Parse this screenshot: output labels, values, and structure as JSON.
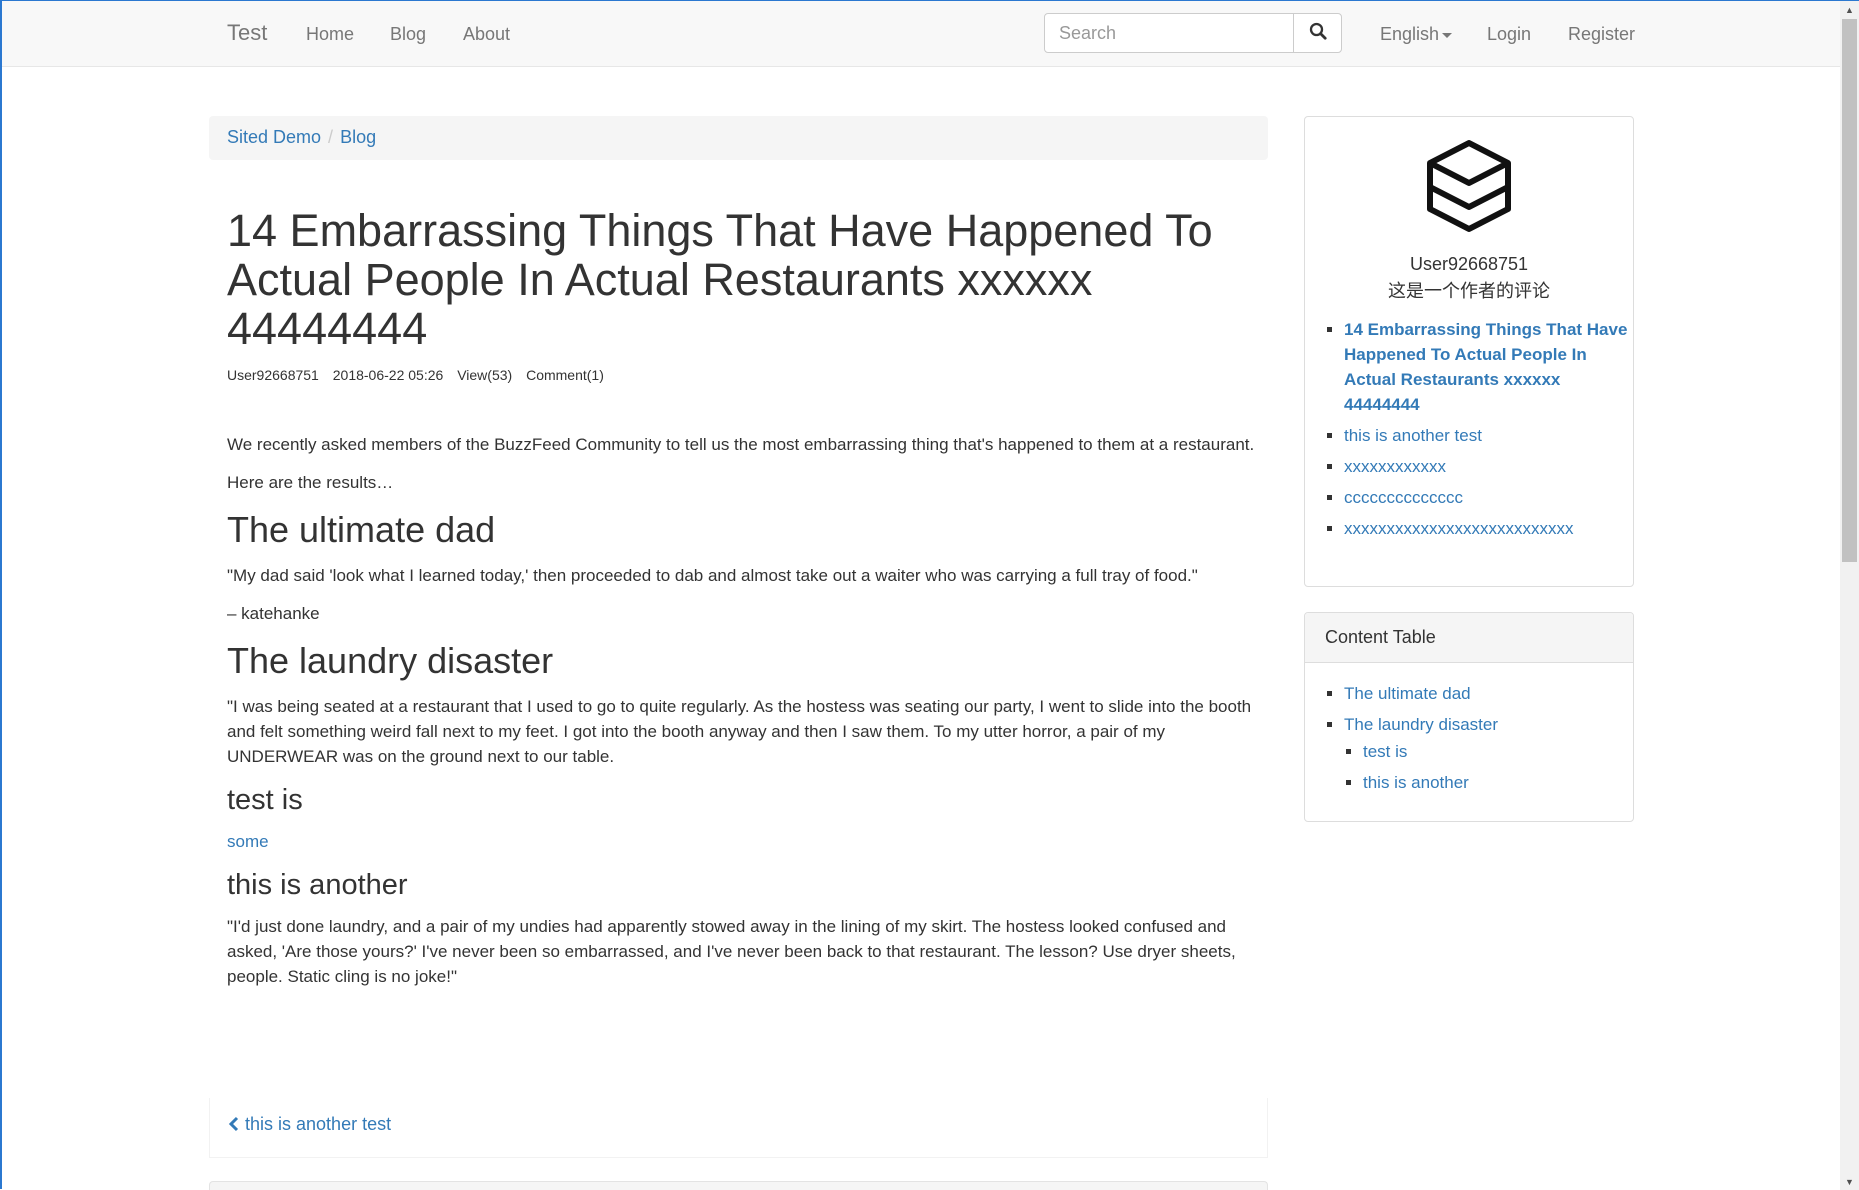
{
  "navbar": {
    "brand": "Test",
    "links": [
      "Home",
      "Blog",
      "About"
    ],
    "search_placeholder": "Search",
    "language": "English",
    "login": "Login",
    "register": "Register"
  },
  "breadcrumb": [
    "Sited Demo",
    "Blog"
  ],
  "article": {
    "title": "14 Embarrassing Things That Have Happened To Actual People In Actual Restaurants xxxxxx 44444444",
    "meta": {
      "author": "User92668751",
      "date": "2018-06-22 05:26",
      "views": "View(53)",
      "comments": "Comment(1)"
    },
    "intro": "We recently asked members of the BuzzFeed Community to tell us the most embarrassing thing that's happened to them at a restaurant.",
    "intro2": "Here are the results…",
    "sections": [
      {
        "heading": "The ultimate dad",
        "para": "\"My dad said 'look what I learned today,' then proceeded to dab and almost take out a waiter who was carrying a full tray of food.\"",
        "para2": "– katehanke"
      },
      {
        "heading": "The laundry disaster",
        "para": "\"I was being seated at a restaurant that I used to go to quite regularly. As the hostess was seating our party, I went to slide into the booth and felt something weird fall next to my feet. I got into the booth anyway and then I saw them. To my utter horror, a pair of my UNDERWEAR was on the ground next to our table."
      },
      {
        "heading": "test is",
        "link": "some"
      },
      {
        "heading": "this is another",
        "para": "\"I'd just done laundry, and a pair of my undies had apparently stowed away in the lining of my skirt. The hostess looked confused and asked, 'Are those yours?' I've never been so embarrassed, and I've never been back to that restaurant. The lesson? Use dryer sheets, people. Static cling is no joke!\""
      }
    ],
    "prev_link": "this is another test"
  },
  "sidebar": {
    "author": {
      "name": "User92668751",
      "bio": "这是一个作者的评论"
    },
    "posts": [
      "14 Embarrassing Things That Have Happened To Actual People In Actual Restaurants xxxxxx 44444444",
      "this is another test",
      "xxxxxxxxxxxx",
      "cccccccccccccc",
      "xxxxxxxxxxxxxxxxxxxxxxxxxxx"
    ],
    "toc": {
      "heading": "Content Table",
      "items": [
        "The ultimate dad",
        "The laundry disaster"
      ],
      "subitems": [
        "test is",
        "this is another"
      ]
    }
  },
  "colors": {
    "link": "#337ab7",
    "text": "#333333",
    "navbar_bg": "#f8f8f8",
    "muted": "#777777"
  }
}
